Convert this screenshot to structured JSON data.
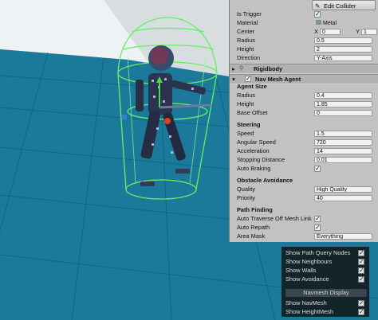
{
  "inspector": {
    "edit_collider": "Edit Collider",
    "collider": {
      "is_trigger_label": "Is Trigger",
      "is_trigger": true,
      "material_label": "Material",
      "material_value": "Metal",
      "center_label": "Center",
      "center_x_label": "X",
      "center_x": "0",
      "center_y_label": "Y",
      "center_y": "1",
      "radius_label": "Radius",
      "radius_value": "0.5",
      "height_label": "Height",
      "height_value": "2",
      "direction_label": "Direction",
      "direction_value": "Y-Axis"
    },
    "rigidbody": {
      "title": "Rigidbody"
    },
    "nav_mesh_agent": {
      "title": "Nav Mesh Agent",
      "agent_size_header": "Agent Size",
      "radius_label": "Radius",
      "radius_value": "0.4",
      "height_label": "Height",
      "height_value": "1.85",
      "base_offset_label": "Base Offset",
      "base_offset_value": "0",
      "steering_header": "Steering",
      "speed_label": "Speed",
      "speed_value": "1.5",
      "angular_speed_label": "Angular Speed",
      "angular_speed_value": "720",
      "acceleration_label": "Acceleration",
      "acceleration_value": "14",
      "stopping_distance_label": "Stopping Distance",
      "stopping_distance_value": "0.01",
      "auto_braking_label": "Auto Braking",
      "auto_braking": true,
      "obstacle_header": "Obstacle Avoidance",
      "quality_label": "Quality",
      "quality_value": "High Quality",
      "priority_label": "Priority",
      "priority_value": "40",
      "path_header": "Path Finding",
      "auto_traverse_label": "Auto Traverse Off Mesh Link",
      "auto_traverse": true,
      "auto_repath_label": "Auto Repath",
      "auto_repath": true,
      "area_mask_label": "Area Mask",
      "area_mask_value": "Everything"
    }
  },
  "navmesh_overlay": {
    "path_query_label": "Show Path Query Nodes",
    "path_query": true,
    "neighbours_label": "Show Neighbours",
    "neighbours": true,
    "walls_label": "Show Walls",
    "walls": true,
    "avoidance_label": "Show Avoidance",
    "avoidance": true,
    "display_header": "Navmesh Display",
    "show_navmesh_label": "Show NavMesh",
    "show_navmesh": true,
    "show_heightmesh_label": "Show HeightMesh",
    "show_heightmesh": true
  },
  "colors": {
    "floor": "#1b7a9a",
    "grid": "#0f5e7a",
    "wall": "#eef2f4",
    "gizmo_green": "#64f064",
    "inspector_bg": "#c2c2c2"
  },
  "checkmark": "✓"
}
